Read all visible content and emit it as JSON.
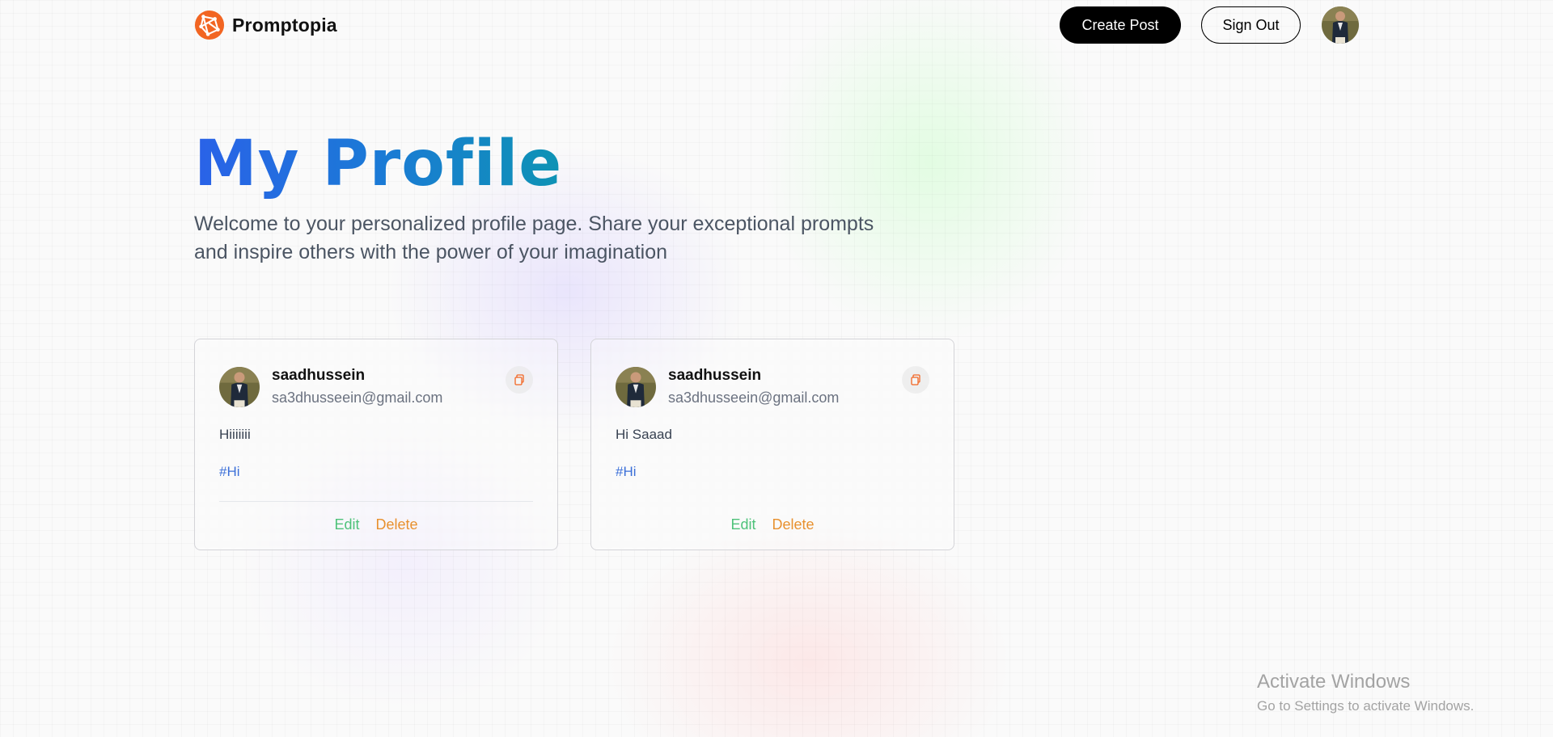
{
  "nav": {
    "brand": "Promptopia",
    "create_post": "Create Post",
    "sign_out": "Sign Out"
  },
  "profile": {
    "title": "My Profile",
    "description": "Welcome to your personalized profile page. Share your exceptional prompts and inspire others with the power of your imagination"
  },
  "posts": [
    {
      "username": "saadhussein",
      "email": "sa3dhusseein@gmail.com",
      "prompt": "Hiiiiiii",
      "tag": "#Hi",
      "edit": "Edit",
      "delete": "Delete"
    },
    {
      "username": "saadhussein",
      "email": "sa3dhusseein@gmail.com",
      "prompt": "Hi Saaad",
      "tag": "#Hi",
      "edit": "Edit",
      "delete": "Delete"
    }
  ],
  "watermark": {
    "title": "Activate Windows",
    "subtitle": "Go to Settings to activate Windows."
  },
  "colors": {
    "brand_orange": "#f26522",
    "title_gradient_start": "#2a62e8",
    "title_gradient_end": "#0e93b4",
    "edit_green": "#4ec27a",
    "delete_orange": "#e8912f",
    "tag_blue": "#3b6fd8"
  },
  "icons": {
    "logo": "promptopia-logo-icon",
    "copy": "copy-icon"
  }
}
